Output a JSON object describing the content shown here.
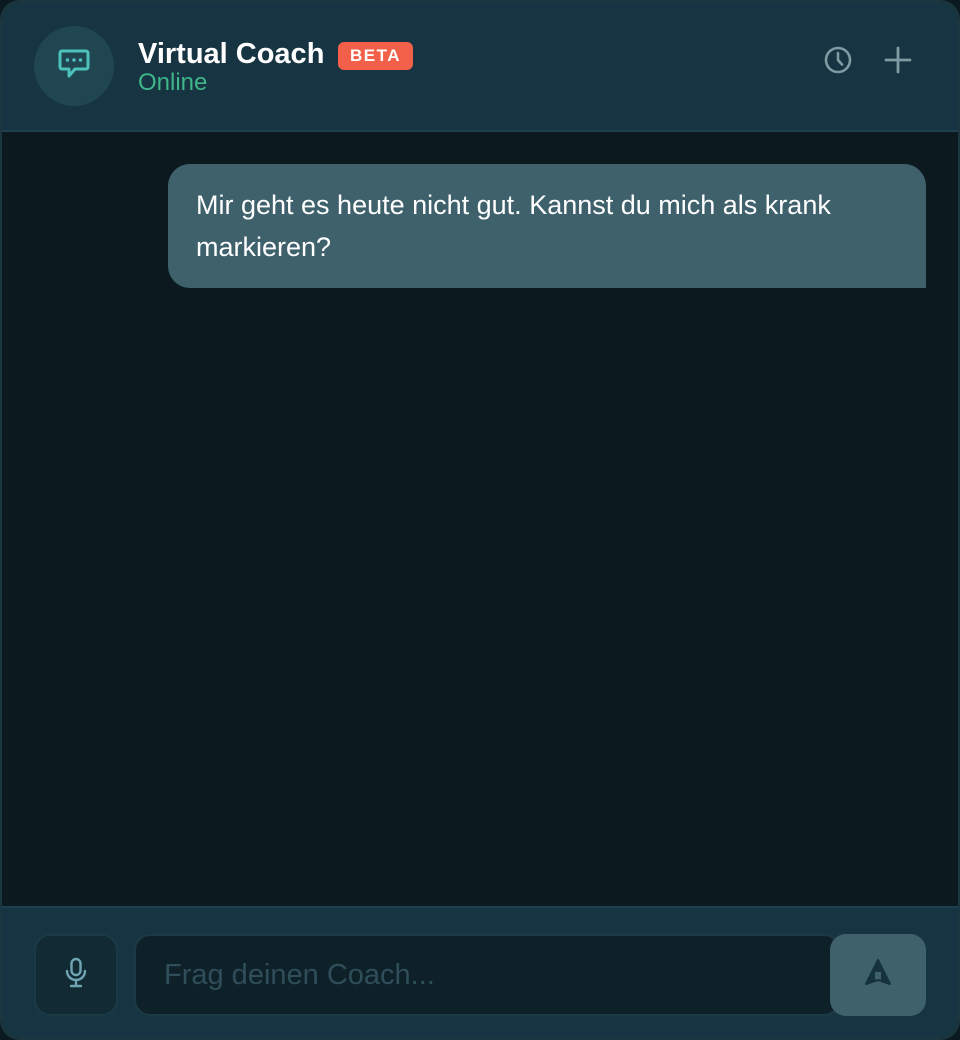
{
  "header": {
    "title": "Virtual Coach",
    "badge": "BETA",
    "status": "Online",
    "avatar_icon": "chat-bubble-icon",
    "actions": [
      {
        "name": "history",
        "icon": "clock-icon"
      },
      {
        "name": "new-chat",
        "icon": "plus-icon"
      }
    ]
  },
  "messages": [
    {
      "role": "user",
      "text": "Mir geht es heute nicht gut. Kannst du mich als krank markieren?"
    }
  ],
  "composer": {
    "placeholder": "Frag deinen Coach...",
    "value": "",
    "mic_icon": "microphone-icon",
    "send_icon": "send-arrow-icon"
  },
  "colors": {
    "header_bg": "#163441",
    "chat_bg": "#0c1a20",
    "accent": "#4fc1bd",
    "status_online": "#3fb58a",
    "badge": "#f2604a",
    "user_bubble": "#3f616c"
  }
}
